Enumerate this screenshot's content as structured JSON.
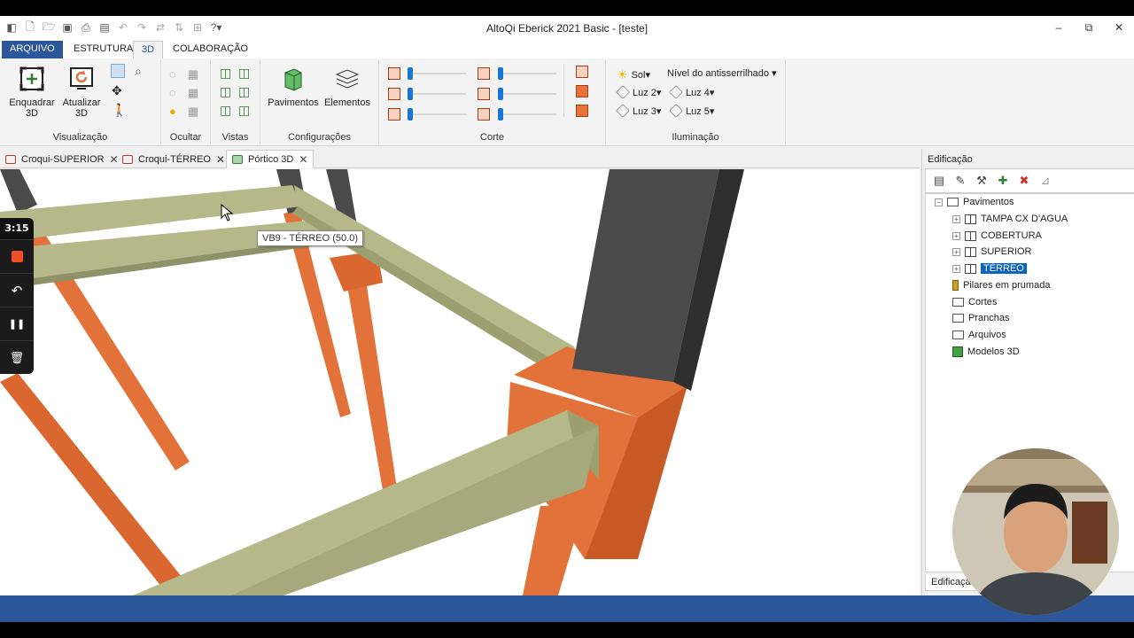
{
  "window": {
    "title": "AltoQi Eberick 2021 Basic - [teste]",
    "controls": {
      "minimize": "–",
      "restore": "⧉",
      "close": "✕"
    }
  },
  "quick_access": [
    "app-icon",
    "new-icon",
    "open-icon",
    "save-icon",
    "print-icon",
    "save-all-icon",
    "undo-icon",
    "redo-icon",
    "tool1-icon",
    "tool2-icon",
    "tool3-icon",
    "help-icon"
  ],
  "ribbon_tabs": {
    "arquivo": "ARQUIVO",
    "estrutura": "ESTRUTURA",
    "tab3d": "3D",
    "colaboracao": "COLABORAÇÃO",
    "active": "3D"
  },
  "ribbon": {
    "visualizacao": {
      "label": "Visualização",
      "enquadrar_line1": "Enquadrar",
      "enquadrar_line2": "3D",
      "atualizar_line1": "Atualizar",
      "atualizar_line2": "3D"
    },
    "ocultar": {
      "label": "Ocultar"
    },
    "vistas": {
      "label": "Vistas"
    },
    "configuracoes": {
      "label": "Configurações",
      "pavimentos": "Pavimentos",
      "elementos": "Elementos"
    },
    "corte": {
      "label": "Corte"
    },
    "iluminacao": {
      "label": "Iluminação",
      "sol": "Sol▾",
      "antialias": "Nível do antisserrilhado ▾",
      "luz2": "Luz 2▾",
      "luz3": "Luz 3▾",
      "luz4": "Luz 4▾",
      "luz5": "Luz 5▾"
    }
  },
  "doc_tabs": [
    {
      "label": "Croqui-SUPERIOR",
      "close": "✕"
    },
    {
      "label": "Croqui-TÉRREO",
      "close": "✕"
    },
    {
      "label": "Pórtico 3D",
      "close": "✕"
    }
  ],
  "viewport": {
    "tooltip": "VB9 - TÉRREO (50.0)"
  },
  "recorder": {
    "time": "3:15",
    "undo_icon": "↶",
    "pause_icon": "❚❚",
    "delete_icon": "🗑"
  },
  "edificacao": {
    "title": "Edificação",
    "bottom_tab": "Edificação",
    "tree": {
      "pavimentos": "Pavimentos",
      "tampa": "TAMPA CX D'AGUA",
      "cobertura": "COBERTURA",
      "superior": "SUPERIOR",
      "terreo": "TÉRREO",
      "pilares": "Pilares em prumada",
      "cortes": "Cortes",
      "pranchas": "Pranchas",
      "arquivos": "Arquivos",
      "modelos": "Modelos 3D"
    },
    "selected": "TÉRREO"
  },
  "colors": {
    "accent": "#2b579a",
    "beam": "#b5b98a",
    "column_orange": "#e2723a",
    "column_dark": "#4a4a4a",
    "selection": "#0a64c8"
  }
}
